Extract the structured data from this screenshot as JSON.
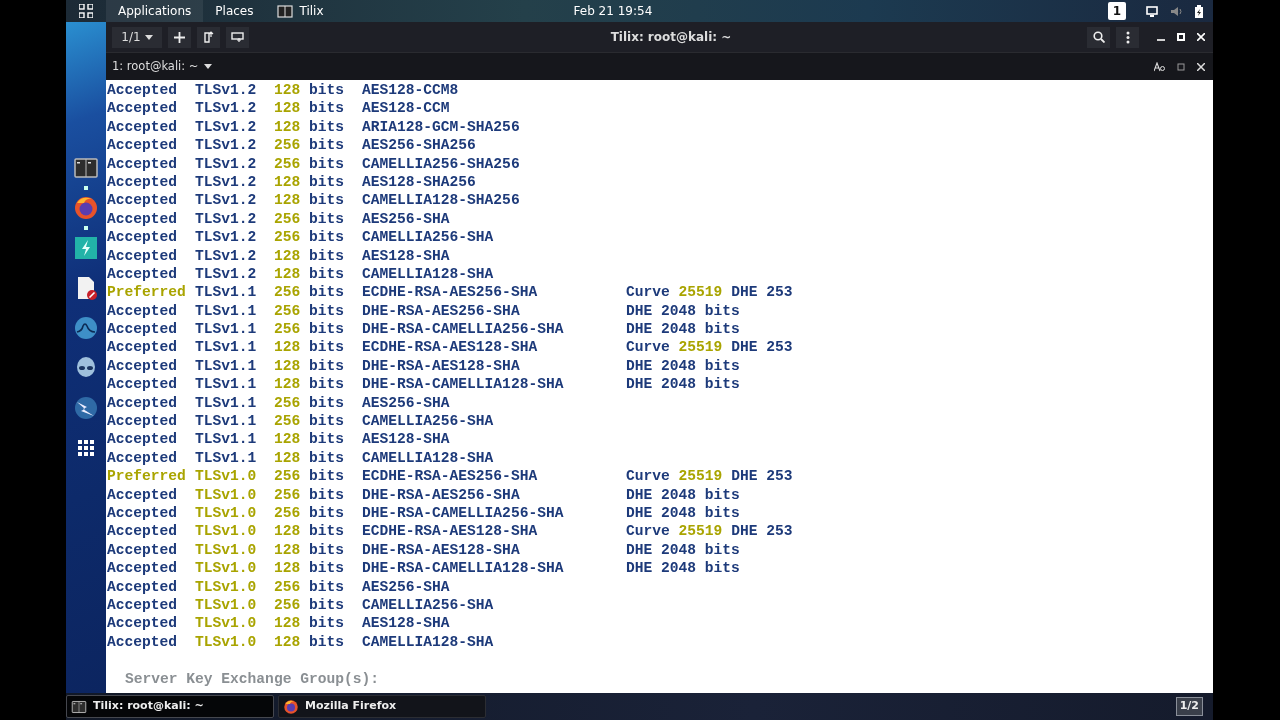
{
  "top_bar": {
    "menus": [
      {
        "label": "Applications",
        "kind": "text",
        "selected": true
      },
      {
        "label": "Places",
        "kind": "text",
        "selected": false
      },
      {
        "label": "Tilix",
        "kind": "terminal",
        "selected": false
      }
    ],
    "clock": "Feb 21 19:54",
    "workspace": "1"
  },
  "dock": {
    "items": [
      {
        "kind": "terminal",
        "running": true
      },
      {
        "kind": "firefox",
        "running": true
      },
      {
        "kind": "bolt",
        "running": false
      },
      {
        "kind": "document",
        "running": false
      },
      {
        "kind": "fin",
        "running": false
      },
      {
        "kind": "alien",
        "running": false
      },
      {
        "kind": "lightning",
        "running": false
      },
      {
        "kind": "apps",
        "running": false
      }
    ]
  },
  "window": {
    "title": "Tilix: root@kali: ~",
    "session_switcher": "1/1",
    "terminal_tab": "1: root@kali: ~"
  },
  "terminal": {
    "rows": [
      {
        "status": "Accepted",
        "preferred": false,
        "protocol": "TLSv1.2",
        "color": "#1d3a7a",
        "bits": "128",
        "unit": "bits",
        "cipher": "AES128-CCM8",
        "extra": []
      },
      {
        "status": "Accepted",
        "preferred": false,
        "protocol": "TLSv1.2",
        "color": "#1d3a7a",
        "bits": "128",
        "unit": "bits",
        "cipher": "AES128-CCM",
        "extra": []
      },
      {
        "status": "Accepted",
        "preferred": false,
        "protocol": "TLSv1.2",
        "color": "#1d3a7a",
        "bits": "128",
        "unit": "bits",
        "cipher": "ARIA128-GCM-SHA256",
        "extra": []
      },
      {
        "status": "Accepted",
        "preferred": false,
        "protocol": "TLSv1.2",
        "color": "#1d3a7a",
        "bits": "256",
        "unit": "bits",
        "cipher": "AES256-SHA256",
        "extra": []
      },
      {
        "status": "Accepted",
        "preferred": false,
        "protocol": "TLSv1.2",
        "color": "#1d3a7a",
        "bits": "256",
        "unit": "bits",
        "cipher": "CAMELLIA256-SHA256",
        "extra": []
      },
      {
        "status": "Accepted",
        "preferred": false,
        "protocol": "TLSv1.2",
        "color": "#1d3a7a",
        "bits": "128",
        "unit": "bits",
        "cipher": "AES128-SHA256",
        "extra": []
      },
      {
        "status": "Accepted",
        "preferred": false,
        "protocol": "TLSv1.2",
        "color": "#1d3a7a",
        "bits": "128",
        "unit": "bits",
        "cipher": "CAMELLIA128-SHA256",
        "extra": []
      },
      {
        "status": "Accepted",
        "preferred": false,
        "protocol": "TLSv1.2",
        "color": "#1d3a7a",
        "bits": "256",
        "unit": "bits",
        "cipher": "AES256-SHA",
        "extra": []
      },
      {
        "status": "Accepted",
        "preferred": false,
        "protocol": "TLSv1.2",
        "color": "#1d3a7a",
        "bits": "256",
        "unit": "bits",
        "cipher": "CAMELLIA256-SHA",
        "extra": []
      },
      {
        "status": "Accepted",
        "preferred": false,
        "protocol": "TLSv1.2",
        "color": "#1d3a7a",
        "bits": "128",
        "unit": "bits",
        "cipher": "AES128-SHA",
        "extra": []
      },
      {
        "status": "Accepted",
        "preferred": false,
        "protocol": "TLSv1.2",
        "color": "#1d3a7a",
        "bits": "128",
        "unit": "bits",
        "cipher": "CAMELLIA128-SHA",
        "extra": []
      },
      {
        "status": "Preferred",
        "preferred": true,
        "protocol": "TLSv1.1",
        "color": "#1d3a7a",
        "bits": "256",
        "unit": "bits",
        "cipher": "ECDHE-RSA-AES256-SHA",
        "extra": [
          {
            "text": "Curve",
            "highlight": false
          },
          {
            "text": "25519",
            "highlight": true
          },
          {
            "text": "DHE 253",
            "highlight": false
          }
        ]
      },
      {
        "status": "Accepted",
        "preferred": false,
        "protocol": "TLSv1.1",
        "color": "#1d3a7a",
        "bits": "256",
        "unit": "bits",
        "cipher": "DHE-RSA-AES256-SHA",
        "extra": [
          {
            "text": "DHE 2048 bits",
            "highlight": false
          }
        ]
      },
      {
        "status": "Accepted",
        "preferred": false,
        "protocol": "TLSv1.1",
        "color": "#1d3a7a",
        "bits": "256",
        "unit": "bits",
        "cipher": "DHE-RSA-CAMELLIA256-SHA",
        "extra": [
          {
            "text": "DHE 2048 bits",
            "highlight": false
          }
        ]
      },
      {
        "status": "Accepted",
        "preferred": false,
        "protocol": "TLSv1.1",
        "color": "#1d3a7a",
        "bits": "128",
        "unit": "bits",
        "cipher": "ECDHE-RSA-AES128-SHA",
        "extra": [
          {
            "text": "Curve",
            "highlight": false
          },
          {
            "text": "25519",
            "highlight": true
          },
          {
            "text": "DHE 253",
            "highlight": false
          }
        ]
      },
      {
        "status": "Accepted",
        "preferred": false,
        "protocol": "TLSv1.1",
        "color": "#1d3a7a",
        "bits": "128",
        "unit": "bits",
        "cipher": "DHE-RSA-AES128-SHA",
        "extra": [
          {
            "text": "DHE 2048 bits",
            "highlight": false
          }
        ]
      },
      {
        "status": "Accepted",
        "preferred": false,
        "protocol": "TLSv1.1",
        "color": "#1d3a7a",
        "bits": "128",
        "unit": "bits",
        "cipher": "DHE-RSA-CAMELLIA128-SHA",
        "extra": [
          {
            "text": "DHE 2048 bits",
            "highlight": false
          }
        ]
      },
      {
        "status": "Accepted",
        "preferred": false,
        "protocol": "TLSv1.1",
        "color": "#1d3a7a",
        "bits": "256",
        "unit": "bits",
        "cipher": "AES256-SHA",
        "extra": []
      },
      {
        "status": "Accepted",
        "preferred": false,
        "protocol": "TLSv1.1",
        "color": "#1d3a7a",
        "bits": "256",
        "unit": "bits",
        "cipher": "CAMELLIA256-SHA",
        "extra": []
      },
      {
        "status": "Accepted",
        "preferred": false,
        "protocol": "TLSv1.1",
        "color": "#1d3a7a",
        "bits": "128",
        "unit": "bits",
        "cipher": "AES128-SHA",
        "extra": []
      },
      {
        "status": "Accepted",
        "preferred": false,
        "protocol": "TLSv1.1",
        "color": "#1d3a7a",
        "bits": "128",
        "unit": "bits",
        "cipher": "CAMELLIA128-SHA",
        "extra": []
      },
      {
        "status": "Preferred",
        "preferred": true,
        "protocol": "TLSv1.0",
        "color": "#a9a400",
        "bits": "256",
        "unit": "bits",
        "cipher": "ECDHE-RSA-AES256-SHA",
        "extra": [
          {
            "text": "Curve",
            "highlight": false
          },
          {
            "text": "25519",
            "highlight": true
          },
          {
            "text": "DHE 253",
            "highlight": false
          }
        ]
      },
      {
        "status": "Accepted",
        "preferred": false,
        "protocol": "TLSv1.0",
        "color": "#a9a400",
        "bits": "256",
        "unit": "bits",
        "cipher": "DHE-RSA-AES256-SHA",
        "extra": [
          {
            "text": "DHE 2048 bits",
            "highlight": false
          }
        ]
      },
      {
        "status": "Accepted",
        "preferred": false,
        "protocol": "TLSv1.0",
        "color": "#a9a400",
        "bits": "256",
        "unit": "bits",
        "cipher": "DHE-RSA-CAMELLIA256-SHA",
        "extra": [
          {
            "text": "DHE 2048 bits",
            "highlight": false
          }
        ]
      },
      {
        "status": "Accepted",
        "preferred": false,
        "protocol": "TLSv1.0",
        "color": "#a9a400",
        "bits": "128",
        "unit": "bits",
        "cipher": "ECDHE-RSA-AES128-SHA",
        "extra": [
          {
            "text": "Curve",
            "highlight": false
          },
          {
            "text": "25519",
            "highlight": true
          },
          {
            "text": "DHE 253",
            "highlight": false
          }
        ]
      },
      {
        "status": "Accepted",
        "preferred": false,
        "protocol": "TLSv1.0",
        "color": "#a9a400",
        "bits": "128",
        "unit": "bits",
        "cipher": "DHE-RSA-AES128-SHA",
        "extra": [
          {
            "text": "DHE 2048 bits",
            "highlight": false
          }
        ]
      },
      {
        "status": "Accepted",
        "preferred": false,
        "protocol": "TLSv1.0",
        "color": "#a9a400",
        "bits": "128",
        "unit": "bits",
        "cipher": "DHE-RSA-CAMELLIA128-SHA",
        "extra": [
          {
            "text": "DHE 2048 bits",
            "highlight": false
          }
        ]
      },
      {
        "status": "Accepted",
        "preferred": false,
        "protocol": "TLSv1.0",
        "color": "#a9a400",
        "bits": "256",
        "unit": "bits",
        "cipher": "AES256-SHA",
        "extra": []
      },
      {
        "status": "Accepted",
        "preferred": false,
        "protocol": "TLSv1.0",
        "color": "#a9a400",
        "bits": "256",
        "unit": "bits",
        "cipher": "CAMELLIA256-SHA",
        "extra": []
      },
      {
        "status": "Accepted",
        "preferred": false,
        "protocol": "TLSv1.0",
        "color": "#a9a400",
        "bits": "128",
        "unit": "bits",
        "cipher": "AES128-SHA",
        "extra": []
      },
      {
        "status": "Accepted",
        "preferred": false,
        "protocol": "TLSv1.0",
        "color": "#a9a400",
        "bits": "128",
        "unit": "bits",
        "cipher": "CAMELLIA128-SHA",
        "extra": []
      }
    ],
    "footer_heading": "Server Key Exchange Group(s):"
  },
  "taskbar": {
    "items": [
      {
        "label": "Tilix: root@kali: ~",
        "kind": "terminal",
        "selected": true
      },
      {
        "label": "Mozilla Firefox",
        "kind": "firefox",
        "selected": false
      }
    ],
    "workspace_indicator": "1/2"
  }
}
